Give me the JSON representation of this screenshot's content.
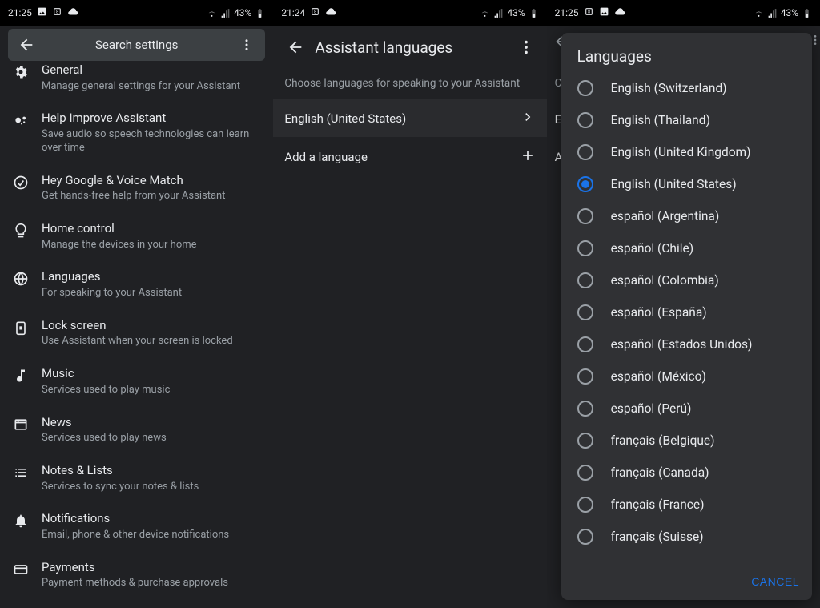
{
  "status": {
    "time1": "21:25",
    "time2": "21:24",
    "time3": "21:25",
    "battery": "43%"
  },
  "screen1": {
    "search_placeholder": "Search settings",
    "items": [
      {
        "icon": "gear",
        "title": "General",
        "sub": "Manage general settings for your Assistant",
        "cut": true
      },
      {
        "icon": "assist",
        "title": "Help Improve Assistant",
        "sub": "Save audio so speech technologies can learn over time"
      },
      {
        "icon": "voice",
        "title": "Hey Google & Voice Match",
        "sub": "Get hands-free help from your Assistant"
      },
      {
        "icon": "bulb",
        "title": "Home control",
        "sub": "Manage the devices in your home"
      },
      {
        "icon": "globe",
        "title": "Languages",
        "sub": "For speaking to your Assistant"
      },
      {
        "icon": "lock",
        "title": "Lock screen",
        "sub": "Use Assistant when your screen is locked"
      },
      {
        "icon": "music",
        "title": "Music",
        "sub": "Services used to play music"
      },
      {
        "icon": "news",
        "title": "News",
        "sub": "Services used to play news"
      },
      {
        "icon": "list",
        "title": "Notes & Lists",
        "sub": "Services to sync your notes & lists"
      },
      {
        "icon": "bell",
        "title": "Notifications",
        "sub": "Email, phone & other device notifications"
      },
      {
        "icon": "card",
        "title": "Payments",
        "sub": "Payment methods & purchase approvals"
      }
    ]
  },
  "screen2": {
    "title": "Assistant languages",
    "header": "Choose languages for speaking to your Assistant",
    "current": "English (United States)",
    "add": "Add a language"
  },
  "screen3": {
    "dialog_title": "Languages",
    "hint_c": "C",
    "hint_e": "E",
    "hint_a": "A",
    "options": [
      {
        "label": "English (Switzerland)",
        "selected": false
      },
      {
        "label": "English (Thailand)",
        "selected": false
      },
      {
        "label": "English (United Kingdom)",
        "selected": false
      },
      {
        "label": "English (United States)",
        "selected": true
      },
      {
        "label": "español (Argentina)",
        "selected": false
      },
      {
        "label": "español (Chile)",
        "selected": false
      },
      {
        "label": "español (Colombia)",
        "selected": false
      },
      {
        "label": "español (España)",
        "selected": false
      },
      {
        "label": "español (Estados Unidos)",
        "selected": false
      },
      {
        "label": "español (México)",
        "selected": false
      },
      {
        "label": "español (Perú)",
        "selected": false
      },
      {
        "label": "français (Belgique)",
        "selected": false
      },
      {
        "label": "français (Canada)",
        "selected": false
      },
      {
        "label": "français (France)",
        "selected": false
      },
      {
        "label": "français (Suisse)",
        "selected": false
      }
    ],
    "cancel": "CANCEL"
  }
}
